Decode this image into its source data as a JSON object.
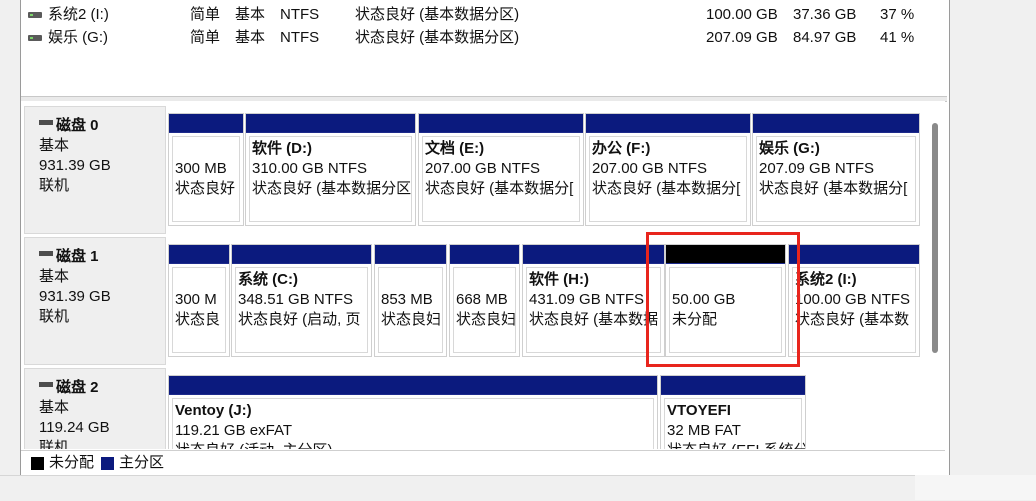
{
  "volumes": [
    {
      "name": "系统2 (I:)",
      "layout": "简单",
      "type": "基本",
      "fs": "NTFS",
      "status": "状态良好 (基本数据分区)",
      "capacity": "100.00 GB",
      "free": "37.36 GB",
      "pct": "37 %"
    },
    {
      "name": "娱乐 (G:)",
      "layout": "简单",
      "type": "基本",
      "fs": "NTFS",
      "status": "状态良好 (基本数据分区)",
      "capacity": "207.09 GB",
      "free": "84.97 GB",
      "pct": "41 %"
    }
  ],
  "disks": [
    {
      "name": "磁盘 0",
      "type": "基本",
      "size": "931.39 GB",
      "state": "联机",
      "partitions": [
        {
          "title": "",
          "line1": "300 MB",
          "line2": "状态良好"
        },
        {
          "title": "软件  (D:)",
          "line1": "310.00 GB NTFS",
          "line2": "状态良好 (基本数据分区"
        },
        {
          "title": "文档  (E:)",
          "line1": "207.00 GB NTFS",
          "line2": "状态良好 (基本数据分["
        },
        {
          "title": "办公  (F:)",
          "line1": "207.00 GB NTFS",
          "line2": "状态良好 (基本数据分["
        },
        {
          "title": "娱乐  (G:)",
          "line1": "207.09 GB NTFS",
          "line2": "状态良好 (基本数据分["
        }
      ]
    },
    {
      "name": "磁盘 1",
      "type": "基本",
      "size": "931.39 GB",
      "state": "联机",
      "partitions": [
        {
          "title": "",
          "line1": "300 M",
          "line2": "状态良"
        },
        {
          "title": "系统  (C:)",
          "line1": "348.51 GB NTFS",
          "line2": "状态良好 (启动, 页"
        },
        {
          "title": "",
          "line1": "853 MB",
          "line2": "状态良妇"
        },
        {
          "title": "",
          "line1": "668 MB",
          "line2": "状态良妇"
        },
        {
          "title": "软件  (H:)",
          "line1": "431.09 GB NTFS",
          "line2": "状态良好 (基本数据"
        },
        {
          "title": "",
          "line1": "50.00 GB",
          "line2": "未分配"
        },
        {
          "title": "系统2  (I:)",
          "line1": "100.00 GB NTFS",
          "line2": "状态良好 (基本数"
        }
      ]
    },
    {
      "name": "磁盘 2",
      "type": "基本",
      "size": "119.24 GB",
      "state": "联机",
      "partitions": [
        {
          "title": "Ventoy  (J:)",
          "line1": "119.21 GB exFAT",
          "line2": "状态良好 (活动, 主分区)"
        },
        {
          "title": "VTOYEFI",
          "line1": "32 MB FAT",
          "line2": "状态良好 (EFI 系统分"
        }
      ]
    }
  ],
  "legend": {
    "unallocated": "未分配",
    "primary": "主分区"
  },
  "colors": {
    "primary_bar": "#0b1a7e",
    "unallocated_bar": "#000000",
    "highlight": "#e8251d"
  }
}
